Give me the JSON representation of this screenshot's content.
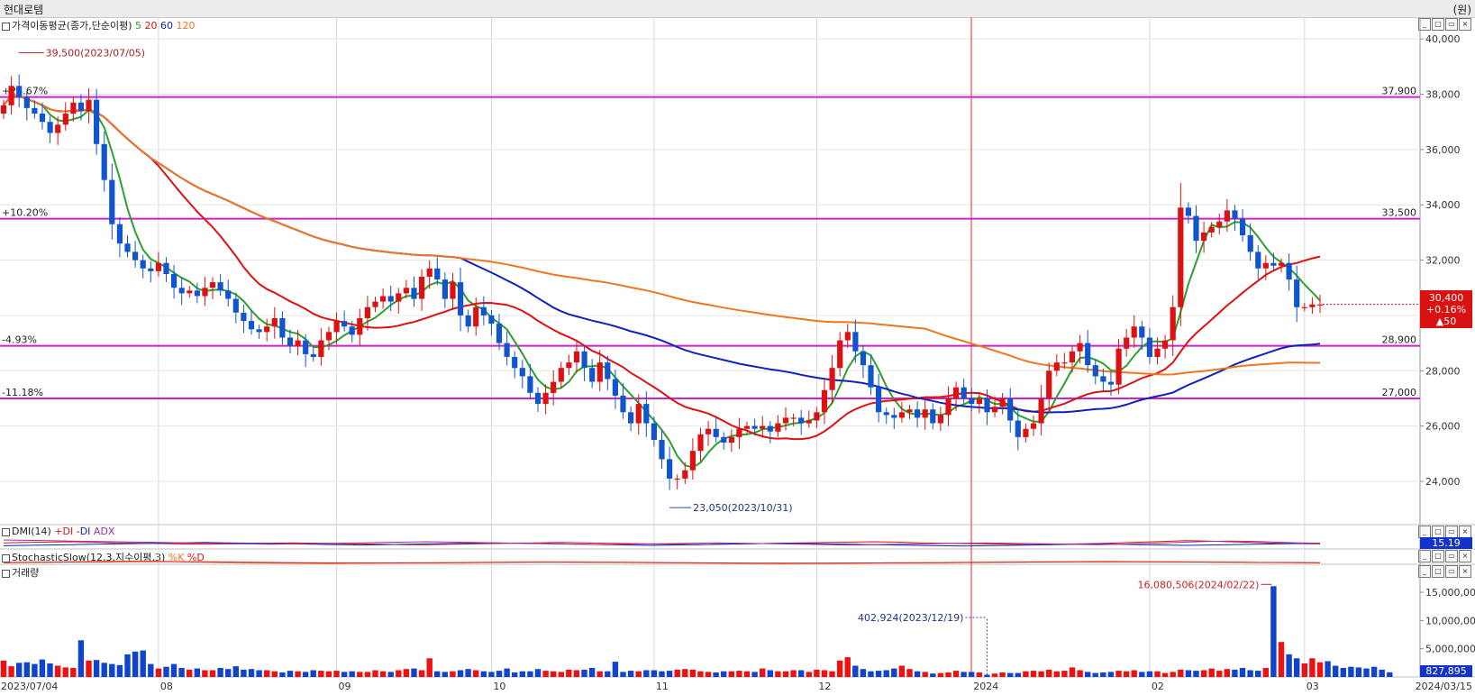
{
  "window": {
    "stock_name": "현대로템",
    "unit": "(원)"
  },
  "panels": {
    "price": {
      "title": "가격이동평균(종가,단순이평)",
      "ma_labels": [
        "5",
        "20",
        "60",
        "120"
      ],
      "ma_colors": [
        "#2ca02c",
        "#dd1111",
        "#1122bb",
        "#ee7722"
      ]
    },
    "dmi": {
      "title": "DMI(14)",
      "series": [
        "+DI",
        "-DI",
        "ADX"
      ],
      "value_box": "15.19"
    },
    "stoch": {
      "title": "StochasticSlow(12,3,지수이평,3)",
      "series": [
        "%K",
        "%D"
      ]
    },
    "volume": {
      "title": "거래량",
      "value_box": "827,895"
    }
  },
  "chart_data": [
    {
      "type": "candlestick",
      "ylim": [
        22500,
        40300
      ],
      "y_ticks": [
        "40,000",
        "38,000",
        "36,000",
        "34,000",
        "32,000",
        "30,000",
        "28,000",
        "26,000",
        "24,000"
      ],
      "x_month_labels": [
        "2023/07/04",
        "08",
        "09",
        "10",
        "11",
        "12",
        "2024",
        "02",
        "03",
        "2024/03/15"
      ],
      "annotations": {
        "high": "39,500(2023/07/05)",
        "low": "23,050(2023/10/31)"
      },
      "levels": [
        {
          "pct": "+24.67%",
          "price": "37,900",
          "value": 37900
        },
        {
          "pct": "+10.20%",
          "price": "33,500",
          "value": 33500
        },
        {
          "pct": "-4.93%",
          "price": "28,900",
          "value": 28900
        },
        {
          "pct": "-11.18%",
          "price": "27,000",
          "value": 27000
        }
      ],
      "current": {
        "price": "30,400",
        "change_pct": "+0.16%",
        "change": "▲50"
      },
      "closes": [
        37600,
        38300,
        37900,
        37500,
        37300,
        37000,
        36600,
        36900,
        37300,
        37700,
        37400,
        37800,
        36200,
        34900,
        33300,
        32600,
        32300,
        32000,
        31700,
        31600,
        31900,
        31500,
        31000,
        30800,
        30900,
        30700,
        31000,
        31200,
        30900,
        30600,
        30100,
        29800,
        29500,
        29400,
        29600,
        29900,
        29200,
        28900,
        29100,
        28600,
        28500,
        29100,
        29400,
        29800,
        29600,
        29300,
        29900,
        30300,
        30500,
        30700,
        30500,
        30800,
        31000,
        30600,
        31400,
        31700,
        31300,
        30600,
        31200,
        30000,
        29600,
        30300,
        30000,
        29700,
        29000,
        28500,
        28100,
        27800,
        27200,
        26800,
        27200,
        27600,
        28100,
        28300,
        28700,
        28100,
        27600,
        28300,
        27700,
        27100,
        26500,
        26100,
        26800,
        26100,
        25500,
        24800,
        24100,
        24100,
        24400,
        25100,
        25700,
        25900,
        25600,
        25400,
        25600,
        25900,
        26000,
        25900,
        26000,
        25800,
        26100,
        26300,
        26300,
        26100,
        26200,
        26500,
        27300,
        28100,
        29100,
        29400,
        28700,
        28200,
        27400,
        26500,
        26400,
        26300,
        26500,
        26600,
        26300,
        26600,
        26100,
        26400,
        27000,
        27400,
        27000,
        26800,
        27000,
        26500,
        26700,
        27000,
        26200,
        25600,
        25900,
        26100,
        27000,
        28000,
        28300,
        28300,
        28700,
        29000,
        28200,
        27800,
        27600,
        27500,
        28800,
        29200,
        29600,
        29200,
        28500,
        28800,
        29100,
        30300,
        33900,
        33600,
        32700,
        33000,
        33200,
        33400,
        33800,
        33500,
        32900,
        32300,
        31700,
        31900,
        31800,
        31900,
        31300,
        30300,
        30300,
        30400,
        30400
      ]
    },
    {
      "type": "line",
      "title": "DMI(14)",
      "series": [
        {
          "name": "+DI",
          "color": "#dd1111",
          "values": [
            22,
            23,
            24,
            25,
            24,
            22,
            21,
            20,
            19,
            18,
            19,
            20,
            21,
            22,
            21,
            20,
            19,
            18,
            17,
            17,
            18,
            19,
            20,
            21,
            22,
            23,
            22,
            21,
            20,
            19,
            18,
            17,
            18,
            19,
            20,
            21,
            22,
            23,
            24,
            25,
            24,
            22,
            21,
            20,
            19,
            18,
            17,
            18,
            19,
            20,
            22,
            24,
            26,
            28,
            27,
            25,
            23,
            21,
            20,
            19
          ]
        },
        {
          "name": "-DI",
          "color": "#1122bb",
          "values": [
            14,
            15,
            16,
            17,
            18,
            19,
            20,
            21,
            22,
            23,
            22,
            21,
            20,
            19,
            18,
            17,
            16,
            17,
            18,
            19,
            20,
            21,
            22,
            21,
            20,
            19,
            18,
            17,
            16,
            15,
            16,
            17,
            18,
            19,
            20,
            21,
            20,
            19,
            18,
            17,
            16,
            15,
            14,
            13,
            14,
            15,
            16,
            17,
            18,
            19,
            18,
            17,
            16,
            15,
            16,
            17,
            18,
            19,
            20,
            21
          ]
        },
        {
          "name": "ADX",
          "color": "#993399",
          "values": [
            30,
            29,
            28,
            27,
            26,
            25,
            24,
            23,
            22,
            21,
            20,
            19,
            18,
            19,
            20,
            21,
            22,
            23,
            24,
            25,
            24,
            23,
            22,
            21,
            20,
            19,
            18,
            17,
            18,
            19,
            20,
            21,
            22,
            21,
            20,
            19,
            18,
            17,
            16,
            17,
            18,
            19,
            20,
            21,
            22,
            21,
            20,
            19,
            18,
            17,
            18,
            20,
            22,
            24,
            26,
            27,
            26,
            24,
            22,
            21
          ]
        }
      ]
    },
    {
      "type": "line",
      "title": "StochasticSlow(12,3,지수이평,3)",
      "series": [
        {
          "name": "%K",
          "color": "#ee7722",
          "values": [
            48,
            50,
            52,
            55,
            57,
            58,
            56,
            53,
            50,
            48,
            47,
            46,
            45,
            46,
            47,
            48,
            49,
            50,
            51,
            52,
            53,
            52,
            51,
            50,
            49,
            48,
            47,
            46,
            45,
            44,
            45,
            46,
            47,
            48,
            49,
            50,
            51,
            52,
            53,
            54,
            55,
            56,
            55,
            54,
            53,
            52,
            51,
            50,
            49,
            48
          ]
        },
        {
          "name": "%D",
          "color": "#dd1111",
          "values": [
            50,
            51,
            52,
            53,
            54,
            55,
            55,
            54,
            53,
            51,
            50,
            49,
            48,
            48,
            48,
            48,
            48,
            49,
            50,
            51,
            52,
            52,
            51,
            51,
            50,
            49,
            48,
            47,
            46,
            46,
            46,
            46,
            47,
            48,
            48,
            49,
            50,
            51,
            52,
            53,
            54,
            54,
            54,
            54,
            53,
            52,
            51,
            50,
            50,
            49
          ]
        }
      ]
    },
    {
      "type": "bar",
      "title": "거래량",
      "ylim": [
        0,
        19000000
      ],
      "y_ticks": [
        "15,000,000",
        "10,000,000",
        "5,000,000"
      ],
      "annotations": {
        "max": "16,080,506(2024/02/22)",
        "min": "402,924(2023/12/19)"
      },
      "values": [
        2900000,
        1900000,
        2500000,
        2600000,
        2300000,
        3100000,
        2400000,
        2000000,
        1700000,
        1600000,
        6500000,
        2900000,
        3000000,
        2500000,
        2300000,
        2100000,
        4000000,
        4500000,
        4700000,
        2300000,
        1500000,
        1800000,
        2300000,
        1600000,
        1300000,
        1500000,
        1200000,
        1200000,
        1600000,
        1400000,
        1900000,
        1300000,
        1400000,
        1200000,
        1200000,
        1000000,
        800000,
        1100000,
        1000000,
        900000,
        1200000,
        1100000,
        1000000,
        1100000,
        900000,
        1000000,
        900000,
        900000,
        1200000,
        1000000,
        900000,
        1200000,
        1400000,
        1500000,
        1200000,
        3300000,
        1000000,
        900000,
        1000000,
        1200000,
        1400000,
        1200000,
        1000000,
        900000,
        1100000,
        1500000,
        800000,
        1000000,
        1000000,
        1400000,
        1100000,
        1000000,
        900000,
        1300000,
        1200000,
        1300000,
        1600000,
        1000000,
        1000000,
        2700000,
        900000,
        1100000,
        1000000,
        1200000,
        1200000,
        1000000,
        1100000,
        1300000,
        1400000,
        1300000,
        1000000,
        900000,
        800000,
        1000000,
        1000000,
        1100000,
        1000000,
        900000,
        1500000,
        1200000,
        1000000,
        1000000,
        1200000,
        1200000,
        900000,
        1300000,
        1200000,
        1000000,
        2900000,
        3500000,
        2000000,
        1400000,
        1000000,
        1100000,
        1200000,
        1500000,
        2000000,
        1400000,
        1000000,
        900000,
        600000,
        700000,
        800000,
        1100000,
        900000,
        900000,
        800000,
        402924,
        600000,
        800000,
        700000,
        700000,
        1000000,
        1100000,
        1000000,
        1300000,
        1000000,
        1100000,
        1700000,
        1200000,
        900000,
        700000,
        800000,
        900000,
        1100000,
        1000000,
        1200000,
        900000,
        1000000,
        1000000,
        700000,
        900000,
        1300000,
        1200000,
        1100000,
        1200000,
        1500000,
        1100000,
        1400000,
        1300000,
        1600000,
        1200000,
        1100000,
        1600000,
        16080506,
        6200000,
        4000000,
        3300000,
        2400000,
        3300000,
        2600000,
        2800000,
        2000000,
        1600000,
        1800000,
        1700000,
        1500000,
        1800000,
        1300000,
        827895
      ]
    }
  ]
}
